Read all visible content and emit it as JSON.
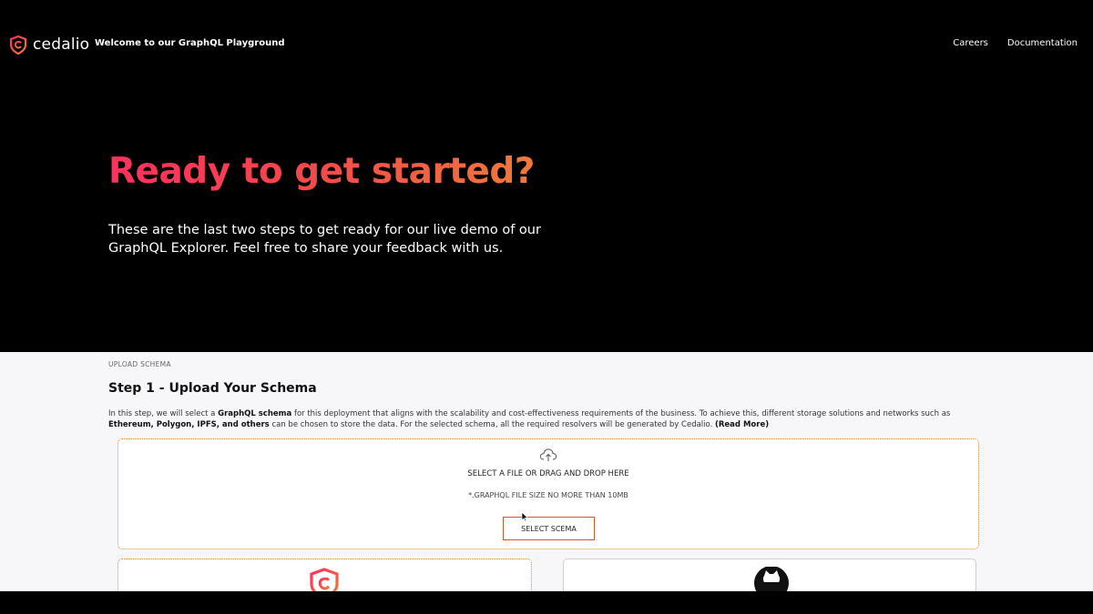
{
  "header": {
    "brand": "cedalio",
    "welcome": "Welcome to our GraphQL Playground",
    "nav": [
      {
        "label": "Careers"
      },
      {
        "label": "Documentation"
      }
    ]
  },
  "hero": {
    "title": "Ready to get started?",
    "subtitle": "These are the last two steps to get ready for our live demo of our GraphQL Explorer. Feel free to share your feedback with us."
  },
  "step1": {
    "section_label": "UPLOAD SCHEMA",
    "title": "Step 1 - Upload Your Schema",
    "desc_part1": "In this step, we will select a ",
    "desc_bold1": "GraphQL schema",
    "desc_part2": " for this deployment that aligns with the scalability and cost-effectiveness requirements of the business. To achieve this, different storage solutions and networks such as ",
    "desc_bold2": "Ethereum, Polygon, IPFS, and others",
    "desc_part3": " can be chosen to store the data. For the selected schema, all the required resolvers will be generated by Cedalio. ",
    "read_more": "(Read More)"
  },
  "dropzone": {
    "title": "SELECT A FILE OR DRAG AND DROP HERE",
    "hint": "*.GRAPHQL FILE SIZE NO MORE THAN 10MB",
    "button": "SELECT SCEMA",
    "icon": "cloud-upload-icon"
  },
  "cards": [
    {
      "icon": "cedalio-logo-icon"
    },
    {
      "icon": "github-icon"
    }
  ],
  "colors": {
    "accent_start": "#ff2f5e",
    "accent_end": "#f07a3a",
    "dropzone_border": "#e08a3c",
    "button_border": "#d2552c"
  }
}
